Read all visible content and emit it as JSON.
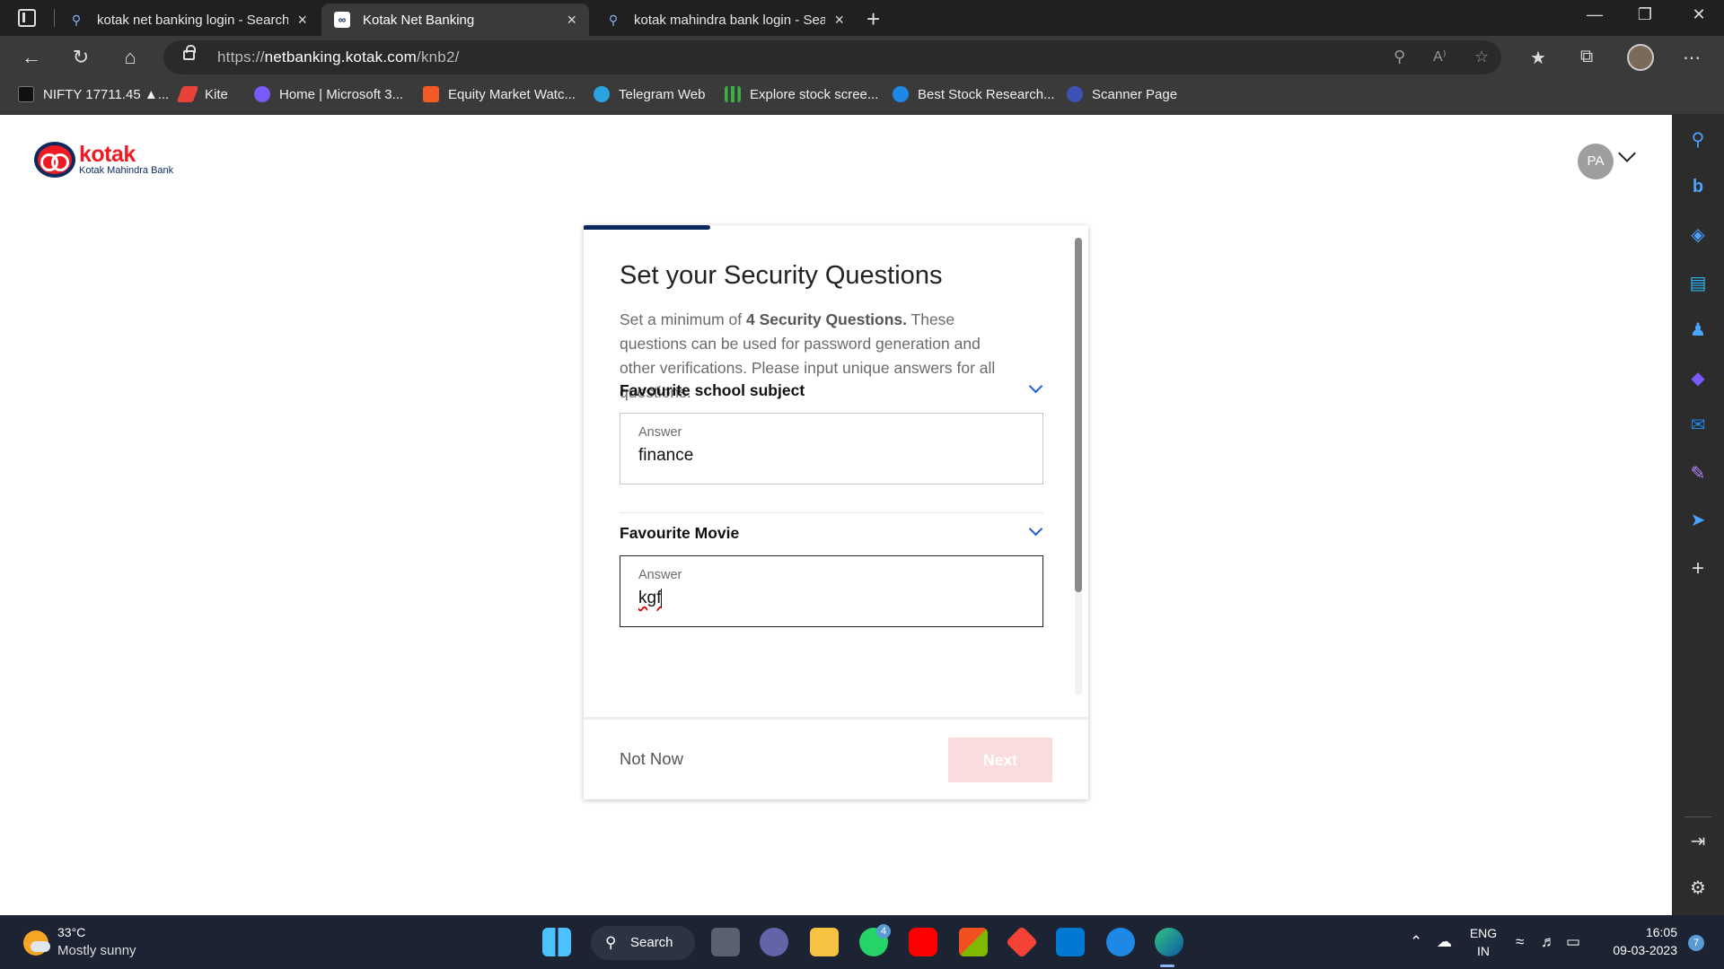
{
  "browser": {
    "tabs": [
      {
        "title": "kotak net banking login - Search",
        "icon": "search-icon",
        "active": false
      },
      {
        "title": "Kotak Net Banking",
        "icon": "kotak-favicon",
        "active": true
      },
      {
        "title": "kotak mahindra bank login - Search",
        "icon": "search-icon",
        "active": false
      }
    ],
    "url_prefix": "https://",
    "url_domain": "netbanking.kotak.com",
    "url_path": "/knb2/",
    "favorites": [
      {
        "label": "NIFTY 17711.45 ▲...",
        "icon": "tradingview-icon",
        "color": "#111111"
      },
      {
        "label": "Kite",
        "icon": "kite-icon",
        "color": "#e8433a"
      },
      {
        "label": "Home | Microsoft 3...",
        "icon": "microsoft365-icon",
        "color": "#7a5af8"
      },
      {
        "label": "Equity Market Watc...",
        "icon": "equity-icon",
        "color": "#f15a24"
      },
      {
        "label": "Telegram Web",
        "icon": "telegram-icon",
        "color": "#2aa3e0"
      },
      {
        "label": "Explore stock scree...",
        "icon": "chart-bars-icon",
        "color": "#3cb043"
      },
      {
        "label": "Best Stock Research...",
        "icon": "research-icon",
        "color": "#1e88e5"
      },
      {
        "label": "Scanner Page",
        "icon": "scanner-icon",
        "color": "#3f51b5"
      }
    ]
  },
  "header": {
    "logo_word": "kotak",
    "logo_sub": "Kotak Mahindra Bank",
    "user_initials": "PA"
  },
  "card": {
    "title": "Set your Security Questions",
    "desc_pre": "Set a minimum of ",
    "desc_bold": "4 Security Questions.",
    "desc_post": " These questions can be used for password generation and other verifications. Please input unique answers for all questions.",
    "questions": [
      {
        "question": "Favourite school subject",
        "answer_label": "Answer",
        "answer": "finance"
      },
      {
        "question": "Favourite Movie",
        "answer_label": "Answer",
        "answer": "kgf"
      }
    ],
    "not_now": "Not Now",
    "next": "Next",
    "progress_fraction": 0.25
  },
  "taskbar": {
    "temp": "33°C",
    "weather": "Mostly sunny",
    "search": "Search",
    "whatsapp_badge": "4",
    "lang_top": "ENG",
    "lang_bottom": "IN",
    "time": "16:05",
    "date": "09-03-2023",
    "notif_count": "7"
  }
}
